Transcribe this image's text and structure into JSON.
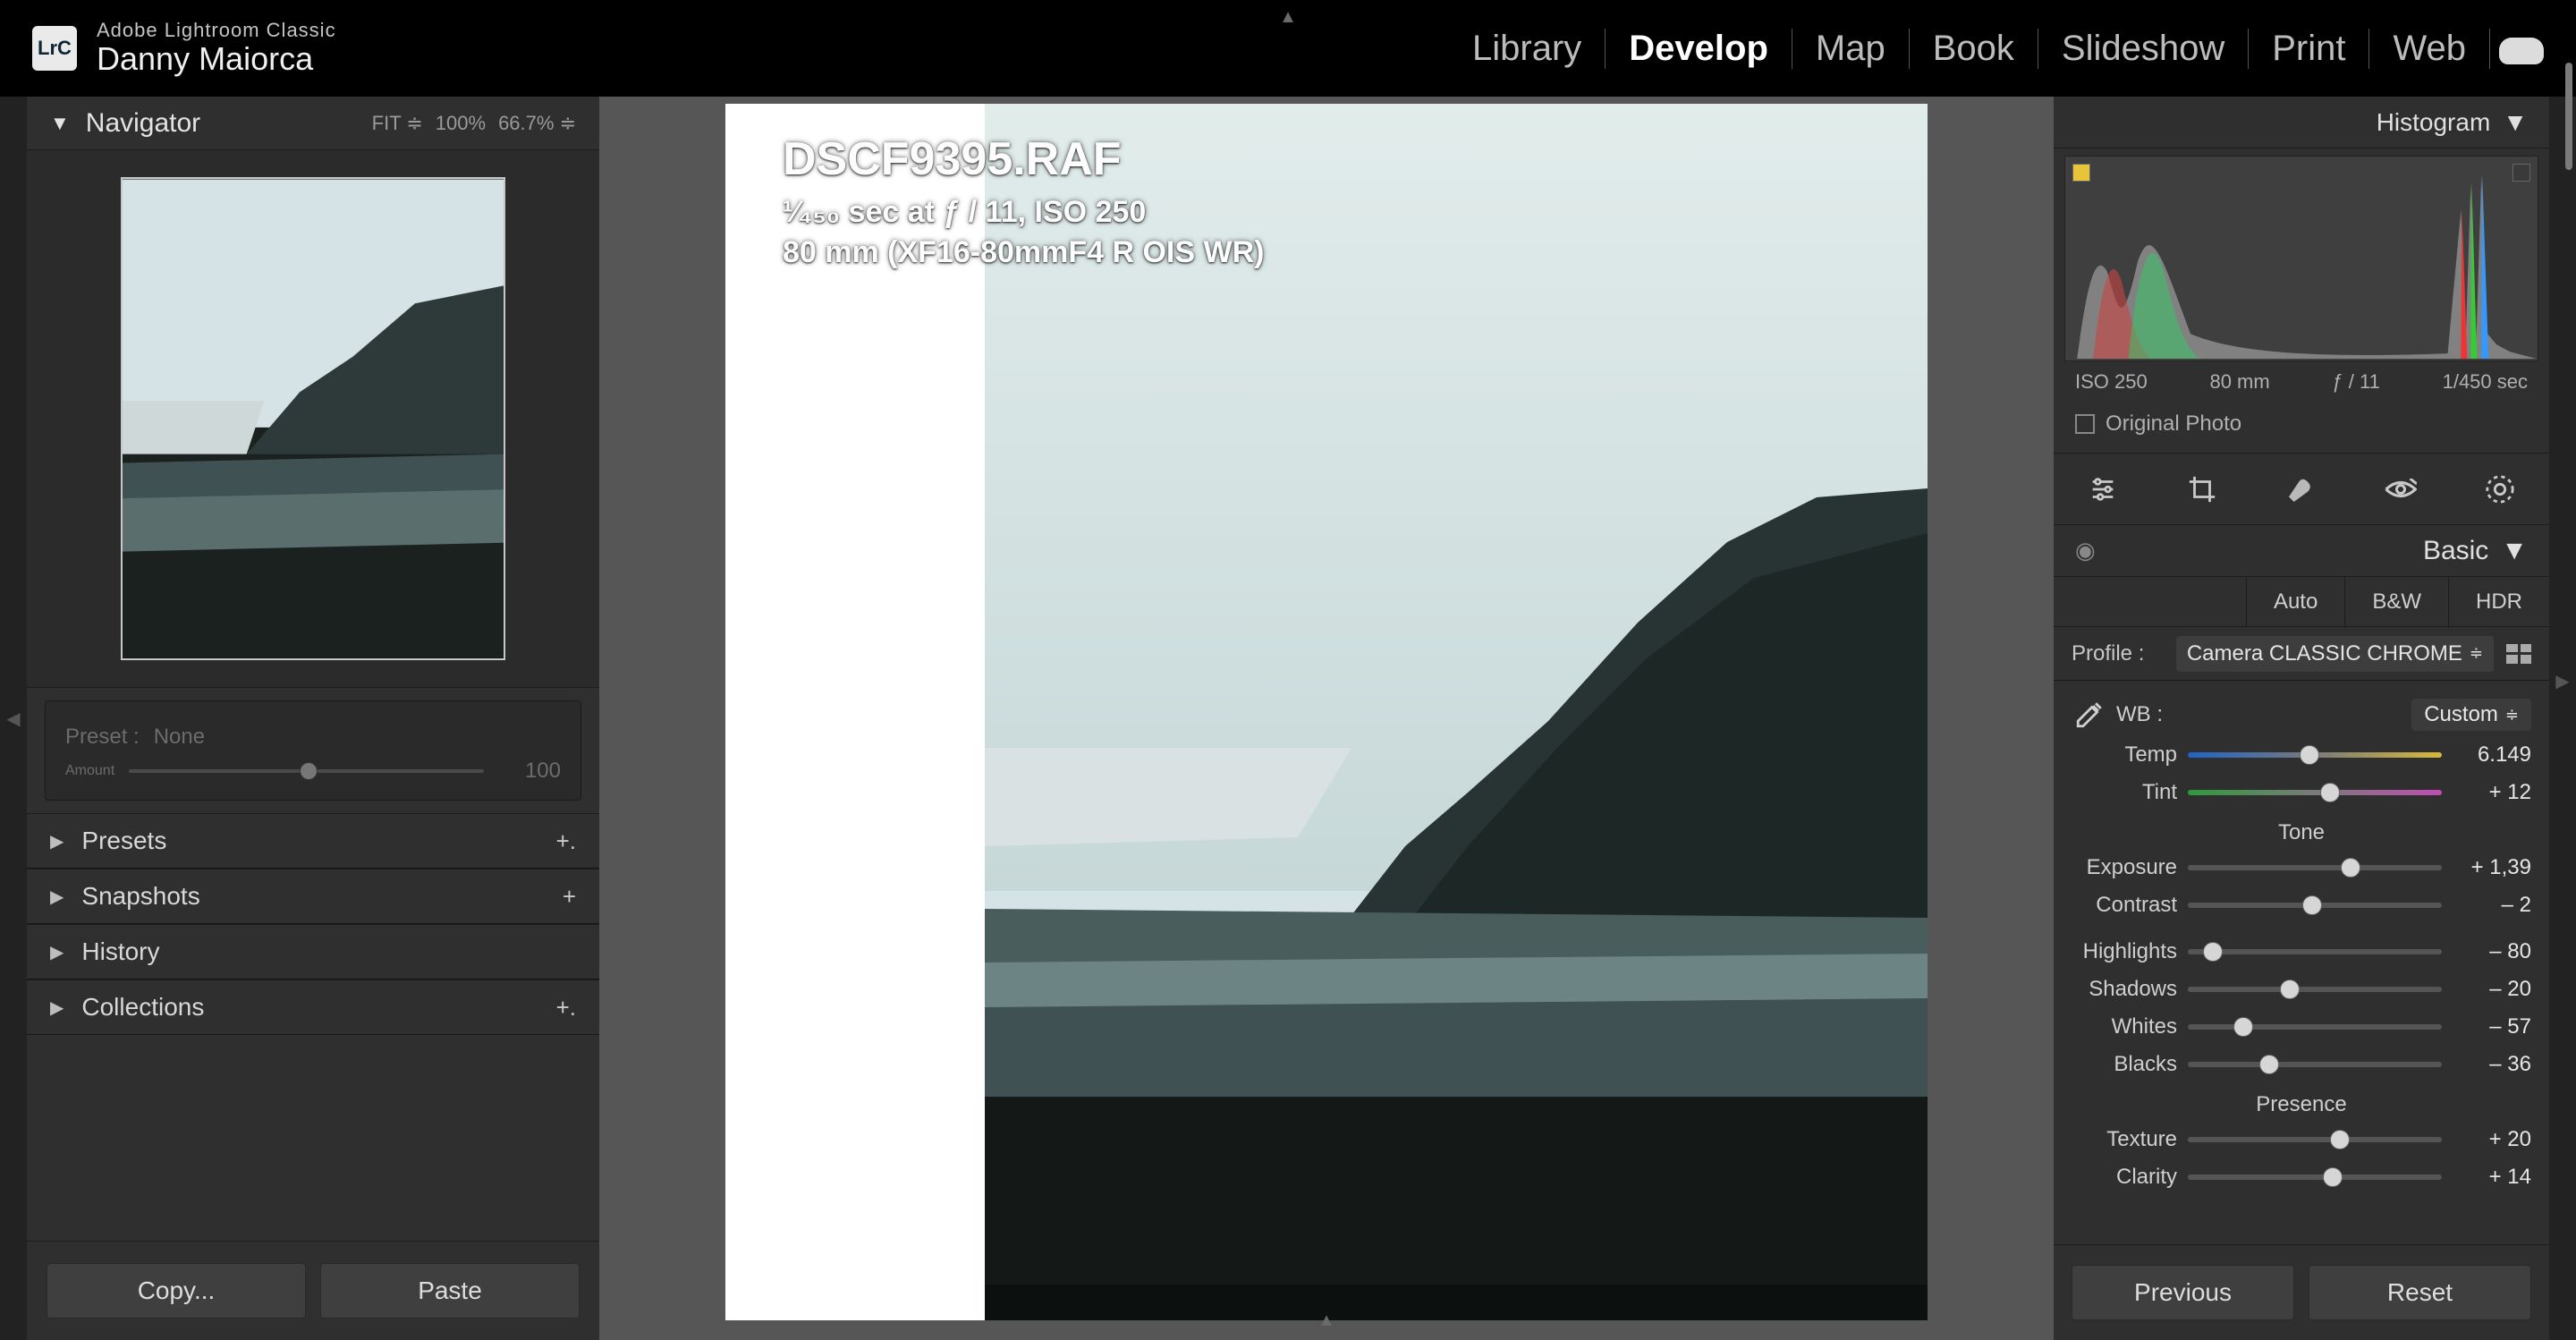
{
  "header": {
    "logo": "LrC",
    "product": "Adobe Lightroom Classic",
    "user": "Danny Maiorca",
    "modules": [
      "Library",
      "Develop",
      "Map",
      "Book",
      "Slideshow",
      "Print",
      "Web"
    ],
    "active_module": "Develop"
  },
  "left_panel": {
    "navigator": {
      "title": "Navigator",
      "zoom_options": [
        "FIT",
        "100%",
        "66.7%"
      ]
    },
    "preset": {
      "label": "Preset :",
      "value": "None",
      "amount_label": "Amount",
      "amount_value": "100"
    },
    "sections": [
      {
        "label": "Presets",
        "action": "+."
      },
      {
        "label": "Snapshots",
        "action": "+"
      },
      {
        "label": "History",
        "action": ""
      },
      {
        "label": "Collections",
        "action": "+."
      }
    ],
    "buttons": {
      "copy": "Copy...",
      "paste": "Paste"
    }
  },
  "image": {
    "filename": "DSCF9395.RAF",
    "exif_line_1": "¹⁄₄₅₀ sec at ƒ / 11, ISO 250",
    "exif_line_2": "80 mm (XF16-80mmF4 R OIS WR)"
  },
  "right_panel": {
    "histogram_title": "Histogram",
    "exif": {
      "iso": "ISO 250",
      "focal": "80 mm",
      "aperture": "ƒ / 11",
      "shutter": "1/450 sec"
    },
    "original_checkbox": "Original Photo",
    "basic": {
      "title": "Basic",
      "modes": [
        "Auto",
        "B&W",
        "HDR"
      ],
      "profile_label": "Profile :",
      "profile_value": "Camera CLASSIC CHROME",
      "wb_label": "WB :",
      "wb_value": "Custom",
      "temp_label": "Temp",
      "temp_value": "6.149",
      "tint_label": "Tint",
      "tint_value": "+ 12",
      "tone_title": "Tone",
      "exposure_label": "Exposure",
      "exposure_value": "+ 1,39",
      "contrast_label": "Contrast",
      "contrast_value": "– 2",
      "highlights_label": "Highlights",
      "highlights_value": "– 80",
      "shadows_label": "Shadows",
      "shadows_value": "– 20",
      "whites_label": "Whites",
      "whites_value": "– 57",
      "blacks_label": "Blacks",
      "blacks_value": "– 36",
      "presence_title": "Presence",
      "texture_label": "Texture",
      "texture_value": "+ 20",
      "clarity_label": "Clarity",
      "clarity_value": "+ 14"
    },
    "buttons": {
      "previous": "Previous",
      "reset": "Reset"
    },
    "slider_positions": {
      "temp": 48,
      "tint": 56,
      "exposure": 64,
      "contrast": 49,
      "highlights": 10,
      "shadows": 40,
      "whites": 22,
      "blacks": 32,
      "texture": 60,
      "clarity": 57
    }
  }
}
